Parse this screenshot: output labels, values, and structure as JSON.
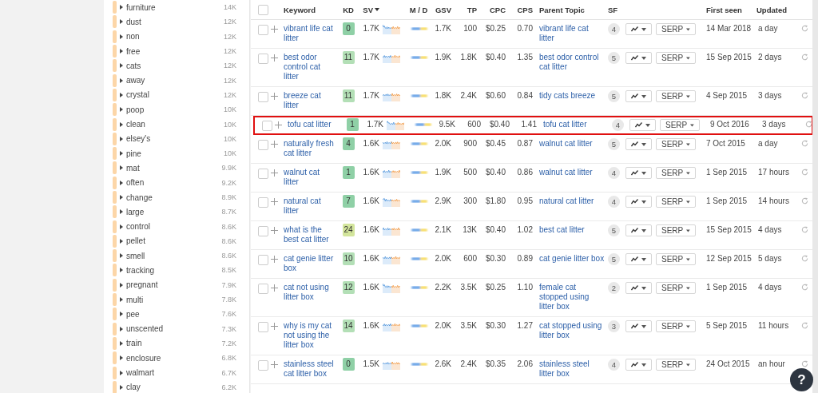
{
  "sidebar": {
    "items": [
      {
        "label": "furniture",
        "count": "14K"
      },
      {
        "label": "dust",
        "count": "12K"
      },
      {
        "label": "non",
        "count": "12K"
      },
      {
        "label": "free",
        "count": "12K"
      },
      {
        "label": "cats",
        "count": "12K"
      },
      {
        "label": "away",
        "count": "12K"
      },
      {
        "label": "crystal",
        "count": "12K"
      },
      {
        "label": "poop",
        "count": "10K"
      },
      {
        "label": "clean",
        "count": "10K"
      },
      {
        "label": "elsey's",
        "count": "10K"
      },
      {
        "label": "pine",
        "count": "10K"
      },
      {
        "label": "mat",
        "count": "9.9K"
      },
      {
        "label": "often",
        "count": "9.2K"
      },
      {
        "label": "change",
        "count": "8.9K"
      },
      {
        "label": "large",
        "count": "8.7K"
      },
      {
        "label": "control",
        "count": "8.6K"
      },
      {
        "label": "pellet",
        "count": "8.6K"
      },
      {
        "label": "smell",
        "count": "8.6K"
      },
      {
        "label": "tracking",
        "count": "8.5K"
      },
      {
        "label": "pregnant",
        "count": "7.9K"
      },
      {
        "label": "multi",
        "count": "7.8K"
      },
      {
        "label": "pee",
        "count": "7.6K"
      },
      {
        "label": "unscented",
        "count": "7.3K"
      },
      {
        "label": "train",
        "count": "7.2K"
      },
      {
        "label": "enclosure",
        "count": "6.8K"
      },
      {
        "label": "walmart",
        "count": "6.7K"
      },
      {
        "label": "clay",
        "count": "6.2K"
      }
    ]
  },
  "table": {
    "select_all": {
      "checked": false
    },
    "columns": [
      "Keyword",
      "KD",
      "SV",
      "M / D",
      "GSV",
      "TP",
      "CPC",
      "CPS",
      "Parent Topic",
      "SF",
      "First seen",
      "Updated"
    ],
    "rows": [
      {
        "checked": false,
        "keyword": "vibrant life cat litter",
        "kd": {
          "text": "0",
          "color": "#8fd0a6"
        },
        "sv": "1.7K",
        "gsv": "1.7K",
        "tp": "100",
        "cpc": "$0.25",
        "cps": "0.70",
        "parent_topic": "vibrant life cat litter",
        "sf": "4",
        "serp": "SERP",
        "first_seen": "14 Mar 2018",
        "updated": "a day",
        "highlighted": false
      },
      {
        "checked": false,
        "keyword": "best odor control cat litter",
        "kd": {
          "text": "11",
          "color": "#b3dfb6"
        },
        "sv": "1.7K",
        "gsv": "1.9K",
        "tp": "1.8K",
        "cpc": "$0.40",
        "cps": "1.35",
        "parent_topic": "best odor control cat litter",
        "sf": "5",
        "serp": "SERP",
        "first_seen": "15 Sep 2015",
        "updated": "2 days",
        "highlighted": false
      },
      {
        "checked": false,
        "keyword": "breeze cat litter",
        "kd": {
          "text": "11",
          "color": "#b3dfb6"
        },
        "sv": "1.7K",
        "gsv": "1.8K",
        "tp": "2.4K",
        "cpc": "$0.60",
        "cps": "0.84",
        "parent_topic": "tidy cats breeze",
        "sf": "5",
        "serp": "SERP",
        "first_seen": "4 Sep 2015",
        "updated": "3 days",
        "highlighted": false
      },
      {
        "checked": false,
        "keyword": "tofu cat litter",
        "kd": {
          "text": "1",
          "color": "#8fd0a6"
        },
        "sv": "1.7K",
        "gsv": "9.5K",
        "tp": "600",
        "cpc": "$0.40",
        "cps": "1.41",
        "parent_topic": "tofu cat litter",
        "sf": "4",
        "serp": "SERP",
        "first_seen": "9 Oct 2016",
        "updated": "3 days",
        "highlighted": true
      },
      {
        "checked": false,
        "keyword": "naturally fresh cat litter",
        "kd": {
          "text": "4",
          "color": "#8fd0a6"
        },
        "sv": "1.6K",
        "gsv": "2.0K",
        "tp": "900",
        "cpc": "$0.45",
        "cps": "0.87",
        "parent_topic": "walnut cat litter",
        "sf": "5",
        "serp": "SERP",
        "first_seen": "7 Oct 2015",
        "updated": "a day",
        "highlighted": false
      },
      {
        "checked": false,
        "keyword": "walnut cat litter",
        "kd": {
          "text": "1",
          "color": "#8fd0a6"
        },
        "sv": "1.6K",
        "gsv": "1.9K",
        "tp": "500",
        "cpc": "$0.40",
        "cps": "0.86",
        "parent_topic": "walnut cat litter",
        "sf": "4",
        "serp": "SERP",
        "first_seen": "1 Sep 2015",
        "updated": "17 hours",
        "highlighted": false
      },
      {
        "checked": false,
        "keyword": "natural cat litter",
        "kd": {
          "text": "7",
          "color": "#8fd0a6"
        },
        "sv": "1.6K",
        "gsv": "2.9K",
        "tp": "300",
        "cpc": "$1.80",
        "cps": "0.95",
        "parent_topic": "natural cat litter",
        "sf": "4",
        "serp": "SERP",
        "first_seen": "1 Sep 2015",
        "updated": "14 hours",
        "highlighted": false
      },
      {
        "checked": false,
        "keyword": "what is the best cat litter",
        "kd": {
          "text": "24",
          "color": "#d3e59c"
        },
        "sv": "1.6K",
        "gsv": "2.1K",
        "tp": "13K",
        "cpc": "$0.40",
        "cps": "1.02",
        "parent_topic": "best cat litter",
        "sf": "5",
        "serp": "SERP",
        "first_seen": "15 Sep 2015",
        "updated": "4 days",
        "highlighted": false
      },
      {
        "checked": false,
        "keyword": "cat genie litter box",
        "kd": {
          "text": "10",
          "color": "#b3dfb6"
        },
        "sv": "1.6K",
        "gsv": "2.0K",
        "tp": "600",
        "cpc": "$0.30",
        "cps": "0.89",
        "parent_topic": "cat genie litter box",
        "sf": "5",
        "serp": "SERP",
        "first_seen": "12 Sep 2015",
        "updated": "5 days",
        "highlighted": false
      },
      {
        "checked": false,
        "keyword": "cat not using litter box",
        "kd": {
          "text": "12",
          "color": "#b3dfb6"
        },
        "sv": "1.6K",
        "gsv": "2.2K",
        "tp": "3.5K",
        "cpc": "$0.25",
        "cps": "1.10",
        "parent_topic": "female cat stopped using litter box",
        "sf": "2",
        "serp": "SERP",
        "first_seen": "1 Sep 2015",
        "updated": "4 days",
        "highlighted": false
      },
      {
        "checked": false,
        "keyword": "why is my cat not using the litter box",
        "kd": {
          "text": "14",
          "color": "#b3dfb6"
        },
        "sv": "1.6K",
        "gsv": "2.0K",
        "tp": "3.5K",
        "cpc": "$0.30",
        "cps": "1.27",
        "parent_topic": "cat stopped using litter box",
        "sf": "3",
        "serp": "SERP",
        "first_seen": "5 Sep 2015",
        "updated": "11 hours",
        "highlighted": false
      },
      {
        "checked": false,
        "keyword": "stainless steel cat litter box",
        "kd": {
          "text": "0",
          "color": "#8fd0a6"
        },
        "sv": "1.5K",
        "gsv": "2.6K",
        "tp": "2.4K",
        "cpc": "$0.35",
        "cps": "2.06",
        "parent_topic": "stainless steel litter box",
        "sf": "4",
        "serp": "SERP",
        "first_seen": "24 Oct 2015",
        "updated": "an hour",
        "highlighted": false
      }
    ]
  },
  "help_button": "?"
}
